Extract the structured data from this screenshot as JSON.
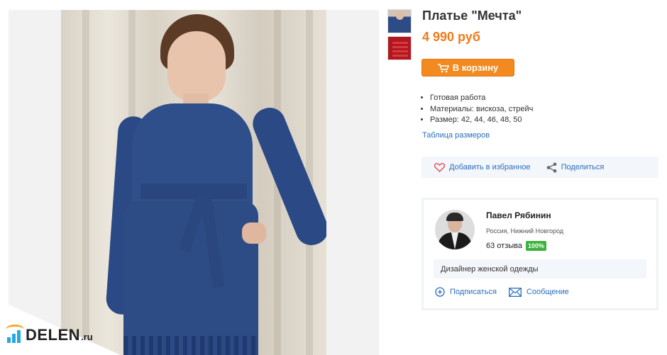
{
  "site": {
    "logo_text": "DELEN",
    "logo_tld": ".ru",
    "brand_color": "#2aa7e0",
    "accent_color": "#f5a623"
  },
  "gallery": {
    "main_image_icon": "product-photo",
    "thumbnails": [
      "thumbnail-dress",
      "thumbnail-label"
    ]
  },
  "product": {
    "title": "Платье \"Мечта\"",
    "price": "4 990 руб",
    "price_color": "#f07a1a",
    "cart_button_label": "В корзину",
    "cart_button_color": "#f28a1f",
    "features": [
      "Готовая работа",
      "Материалы:  вискоза, стрейч",
      "Размер: 42, 44, 46, 48, 50"
    ],
    "size_table_link": "Таблица размеров",
    "add_favorite_label": "Добавить в избранное",
    "share_label": "Поделиться"
  },
  "seller": {
    "name": "Павел Рябинин",
    "location": "Россия, Нижний Новгород",
    "reviews": "63 отзыва",
    "rating_badge": "100%",
    "badge_color": "#3bb33b",
    "description": "Дизайнер женской одежды",
    "subscribe_label": "Подписаться",
    "message_label": "Сообщение"
  }
}
